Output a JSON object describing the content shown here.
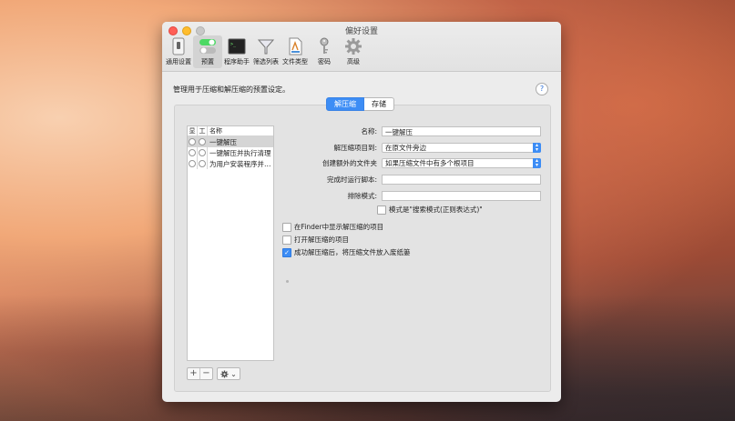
{
  "window": {
    "title": "偏好设置"
  },
  "toolbar": [
    {
      "label": "通用设置",
      "icon": "switch-icon"
    },
    {
      "label": "预置",
      "icon": "toggle-icon",
      "active": true
    },
    {
      "label": "程序助手",
      "icon": "terminal-icon"
    },
    {
      "label": "筛选列表",
      "icon": "filter-icon"
    },
    {
      "label": "文件类型",
      "icon": "document-icon"
    },
    {
      "label": "密码",
      "icon": "key-icon"
    },
    {
      "label": "高级",
      "icon": "gear-icon"
    }
  ],
  "description": "管理用于压缩和解压缩的预置设定。",
  "help": "?",
  "segments": {
    "active": "解压缩",
    "inactive": "存储"
  },
  "list": {
    "headers": [
      "显",
      "工",
      "名称"
    ],
    "rows": [
      {
        "name": "一键解压",
        "selected": true
      },
      {
        "name": "一键解压并执行清理"
      },
      {
        "name": "为用户安装程序并…"
      }
    ]
  },
  "buttons": {
    "plus": "+",
    "minus": "−",
    "gear_chevron": "⌄"
  },
  "form": {
    "name_label": "名称:",
    "name_value": "一键解压",
    "extract_to_label": "解压缩项目到:",
    "extract_to_value": "在原文件旁边",
    "create_folder_label": "创建额外的文件夹",
    "create_folder_value": "如果压缩文件中有多个根项目",
    "run_script_label": "完成时运行脚本:",
    "run_script_value": "",
    "exclude_label": "排除模式:",
    "exclude_value": "",
    "pattern_checkbox": "模式是\"搜索模式(正则表达式)\""
  },
  "checkboxes": [
    {
      "label": "在Finder中显示解压缩的项目",
      "checked": false
    },
    {
      "label": "打开解压缩的项目",
      "checked": false
    },
    {
      "label": "成功解压缩后，将压缩文件放入废纸篓",
      "checked": true
    }
  ]
}
